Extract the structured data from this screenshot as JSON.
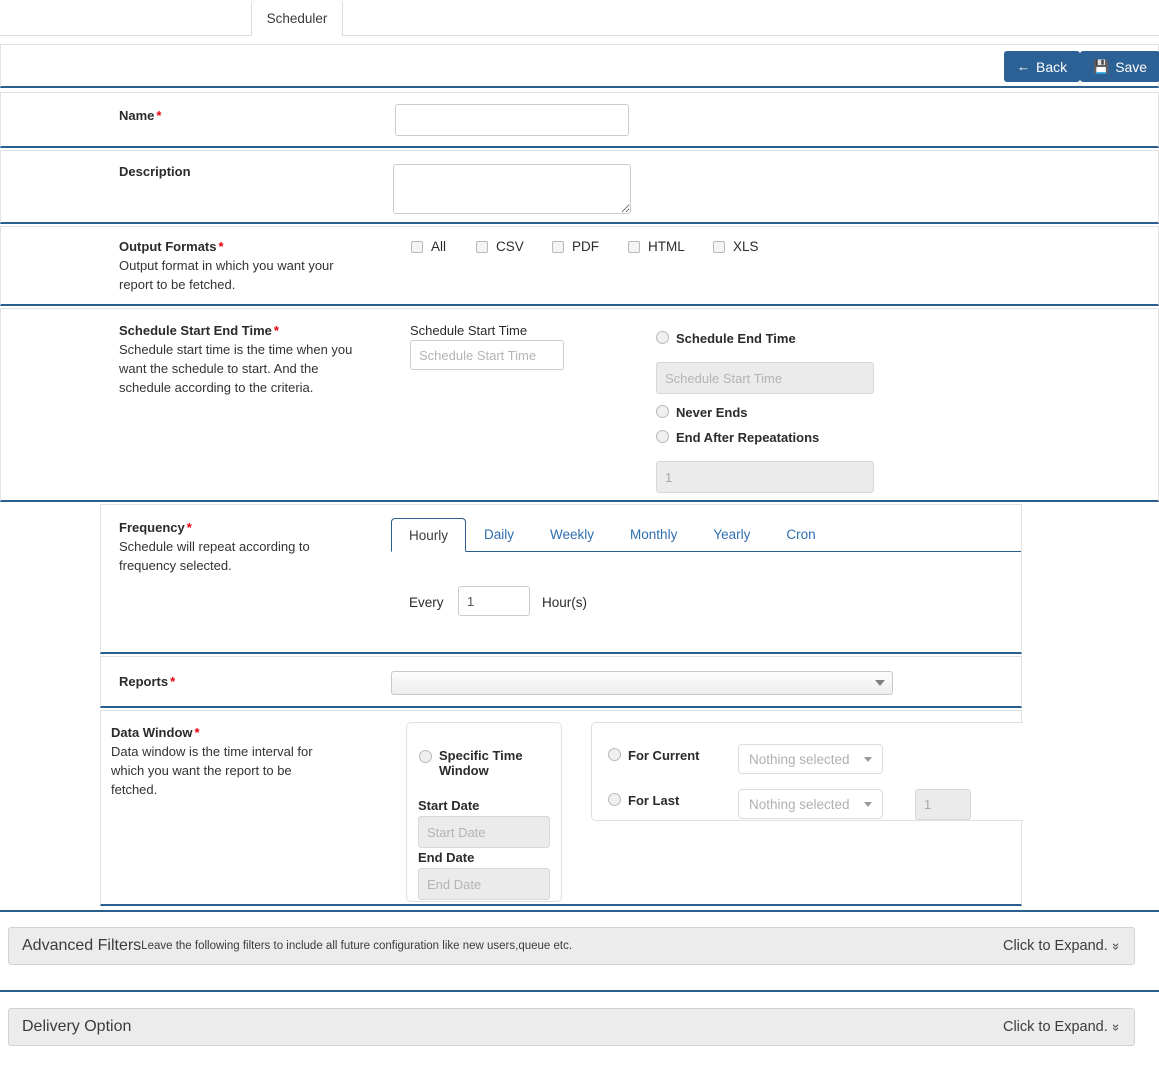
{
  "tab": {
    "label": "Scheduler"
  },
  "toolbar": {
    "back_label": "Back",
    "back_icon": "arrow-left-icon",
    "save_label": "Save",
    "save_icon": "floppy-disk-icon",
    "accent_color": "#2c6196"
  },
  "sections": {
    "name": {
      "label": "Name",
      "required": "*",
      "value": "",
      "placeholder": ""
    },
    "description": {
      "label": "Description",
      "value": "",
      "placeholder": ""
    },
    "output_formats": {
      "label": "Output Formats",
      "required": "*",
      "desc": "Output format in which you want your report to be fetched.",
      "options": [
        {
          "label": "All",
          "checked": false
        },
        {
          "label": "CSV",
          "checked": false
        },
        {
          "label": "PDF",
          "checked": false
        },
        {
          "label": "HTML",
          "checked": false
        },
        {
          "label": "XLS",
          "checked": false
        }
      ]
    },
    "schedule_time": {
      "label": "Schedule Start End Time",
      "required": "*",
      "desc": "Schedule start time is the time when you want the schedule to start. And the schedule according to the criteria.",
      "start_label": "Schedule Start Time",
      "start_placeholder": "Schedule Start Time",
      "start_value": "",
      "end_radio": "Schedule End Time",
      "end_placeholder": "Schedule Start Time",
      "end_value": "",
      "never_ends_radio": "Never Ends",
      "repeat_radio": "End After Repeatations",
      "repeat_value": "1"
    },
    "frequency": {
      "label": "Frequency",
      "required": "*",
      "desc": "Schedule will repeat according to frequency selected.",
      "tabs": [
        {
          "label": "Hourly",
          "active": true
        },
        {
          "label": "Daily",
          "active": false
        },
        {
          "label": "Weekly",
          "active": false
        },
        {
          "label": "Monthly",
          "active": false
        },
        {
          "label": "Yearly",
          "active": false
        },
        {
          "label": "Cron",
          "active": false
        }
      ],
      "every_label": "Every",
      "every_value": "1",
      "unit_label": "Hour(s)"
    },
    "reports": {
      "label": "Reports",
      "required": "*",
      "selected": "",
      "icon": "chevron-down-icon"
    },
    "data_window": {
      "label": "Data Window",
      "required": "*",
      "desc": "Data window is the time interval for which you want the report to be fetched.",
      "specific_radio": "Specific Time Window",
      "start_date_label": "Start Date",
      "start_date_placeholder": "Start Date",
      "start_date_value": "",
      "end_date_label": "End Date",
      "end_date_placeholder": "End Date",
      "end_date_value": "",
      "for_current_radio": "For Current",
      "for_current_select": "Nothing selected",
      "for_last_radio": "For Last",
      "for_last_select": "Nothing selected",
      "for_last_count": "1"
    }
  },
  "advanced_filters": {
    "title": "Advanced Filters",
    "subtitle": "Leave the following filters to include all future configuration like new users,queue etc.",
    "expand_label": "Click to Expand.",
    "expand_icon": "double-chevron-down-icon"
  },
  "delivery_option": {
    "title": "Delivery Option",
    "subtitle": "",
    "expand_label": "Click to Expand.",
    "expand_icon": "double-chevron-down-icon"
  }
}
